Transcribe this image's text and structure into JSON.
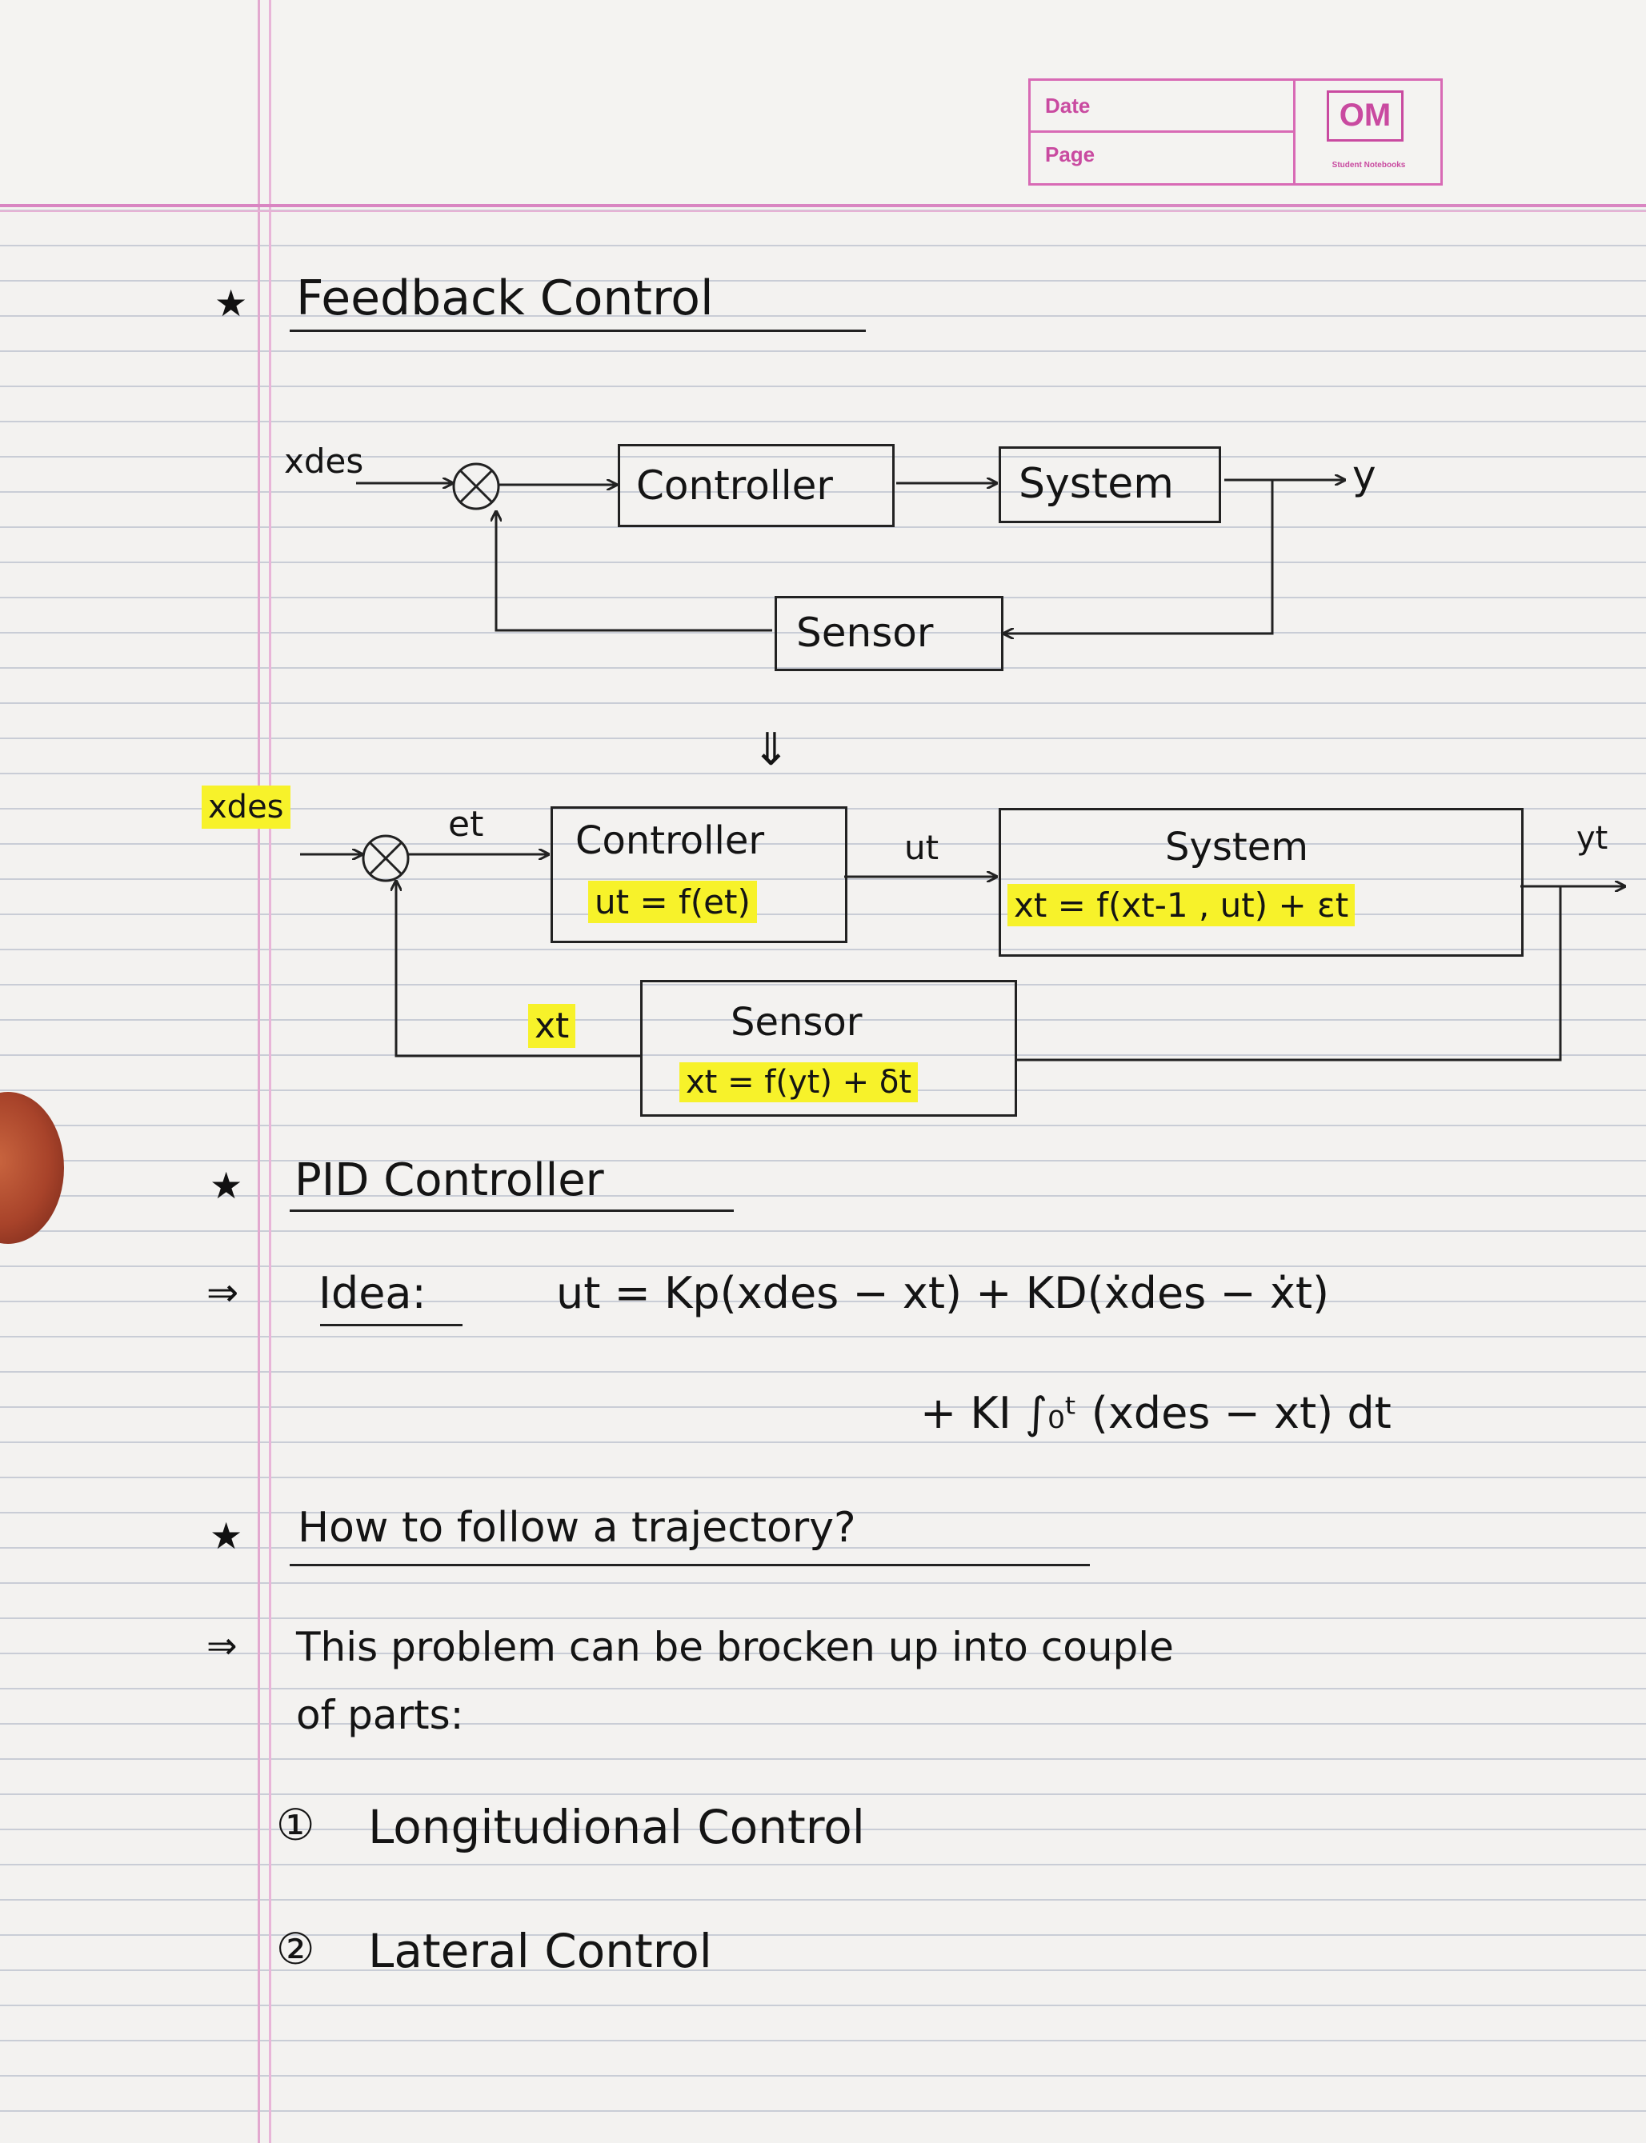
{
  "notebook_header": {
    "date_label": "Date",
    "page_label": "Page",
    "logo_text": "OM",
    "logo_tagline": "Student Notebooks"
  },
  "headings": {
    "feedback": "Feedback Control",
    "pid": "PID Controller",
    "trajectory": "How to follow a trajectory?"
  },
  "diagram1": {
    "input": "xdes",
    "controller": "Controller",
    "system": "System",
    "output": "y",
    "sensor": "Sensor",
    "arrow": "⇓"
  },
  "diagram2": {
    "input": "xdes",
    "error": "et",
    "controller_title": "Controller",
    "controller_eq": "ut = f(et)",
    "control_signal": "ut",
    "system_title": "System",
    "system_eq": "xt = f(xt-1 , ut) + εt",
    "output": "yt",
    "feedback": "xt",
    "sensor_title": "Sensor",
    "sensor_eq": "xt = f(yt) + δt"
  },
  "pid": {
    "idea_label": "Idea:",
    "eq_line1": "ut = Kp(xdes − xt) + KD(ẋdes − ẋt)",
    "eq_line2": "+ KI ∫₀ᵗ (xdes − xt) dt"
  },
  "trajectory": {
    "sentence_line1": "This problem can be brocken up into couple",
    "sentence_line2": "of parts:",
    "items": [
      "Longitudional Control",
      "Lateral Control"
    ]
  }
}
